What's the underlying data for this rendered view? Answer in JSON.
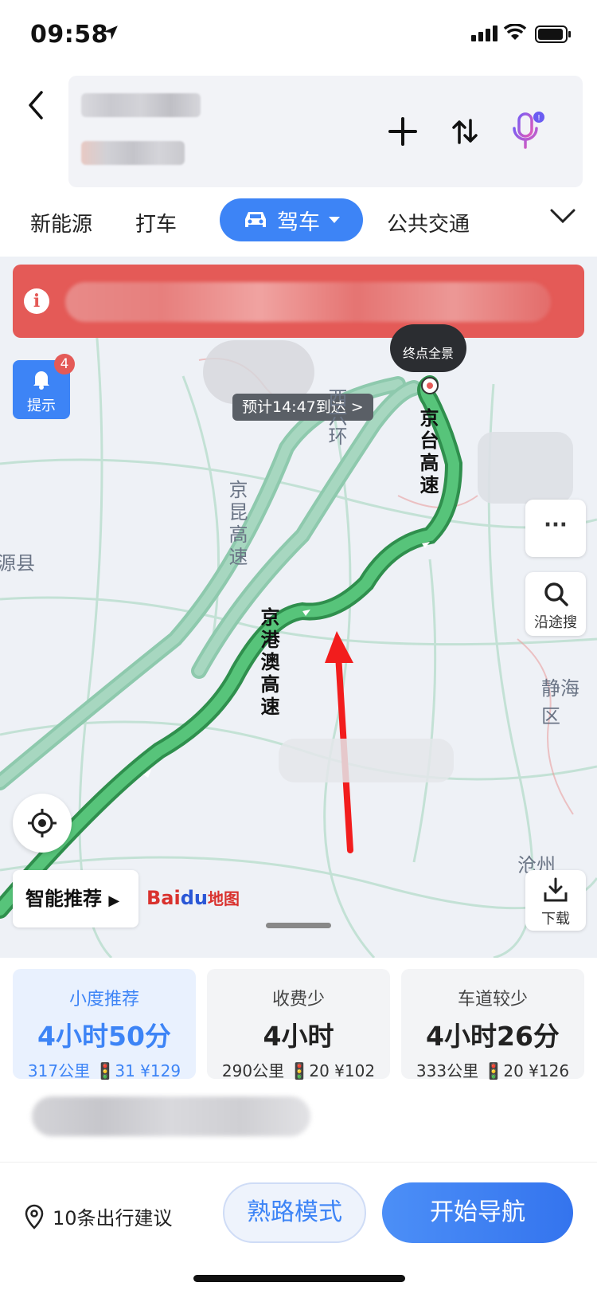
{
  "status": {
    "time": "09:58"
  },
  "header": {
    "back_icon": "chevron-left-icon",
    "add_icon": "plus-icon",
    "swap_icon": "swap-icon",
    "voice_icon": "microphone-icon"
  },
  "tabs": {
    "items": [
      "新能源",
      "打车",
      "驾车",
      "公共交通"
    ],
    "active": "驾车",
    "more_icon": "chevron-down-icon"
  },
  "map": {
    "alert_icon": "info-icon",
    "tip": {
      "label": "提示",
      "badge": "4"
    },
    "eta": "预计14:47到达 >",
    "destination": "终点全景",
    "road_labels": [
      "京台高速",
      "西六环",
      "京昆高速",
      "京港澳高速"
    ],
    "place_labels": [
      "源县",
      "静海区",
      "沧州"
    ],
    "more_label": "···",
    "search_along": "沿途搜",
    "download": "下载",
    "smart_recommend": "智能推荐",
    "logo": {
      "bai": "Bai",
      "du": "du",
      "map": "地图"
    }
  },
  "routes": [
    {
      "label": "小度推荐",
      "duration": "4小时50分",
      "meta": "317公里 🚦31 ¥129",
      "selected": true
    },
    {
      "label": "收费少",
      "duration": "4小时",
      "meta": "290公里 🚦20 ¥102",
      "selected": false
    },
    {
      "label": "车道较少",
      "duration": "4小时26分",
      "meta": "333公里 🚦20 ¥126",
      "selected": false
    }
  ],
  "bottom": {
    "advice": "10条出行建议",
    "familiar_mode": "熟路模式",
    "start_navigation": "开始导航"
  },
  "colors": {
    "accent": "#3d84f6",
    "alert": "#e45a57",
    "route": "#4cb86a",
    "alt_route": "#8ec9ad"
  }
}
